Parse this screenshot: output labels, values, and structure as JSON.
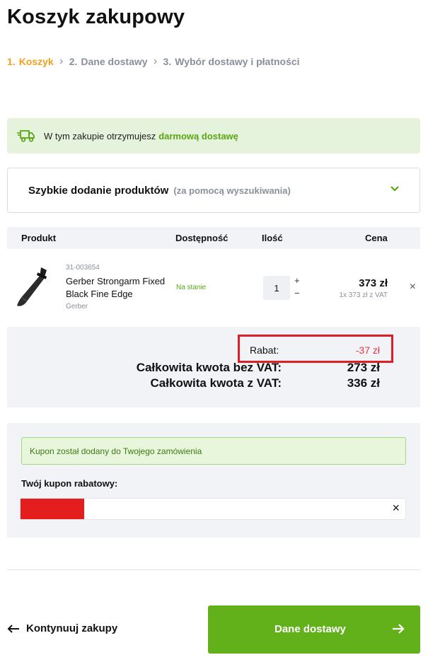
{
  "page": {
    "title": "Koszyk zakupowy"
  },
  "steps": [
    {
      "num": "1.",
      "label": "Koszyk"
    },
    {
      "num": "2.",
      "label": "Dane dostawy"
    },
    {
      "num": "3.",
      "label": "Wybór dostawy i płatności"
    }
  ],
  "promo": {
    "text": "W tym zakupie otrzymujesz",
    "highlight": "darmową dostawę",
    "icon": "truck-icon"
  },
  "quick_add": {
    "title": "Szybkie dodanie produktów",
    "subtitle": "(za pomocą wyszukiwania)",
    "icon": "chevron-down-icon"
  },
  "table": {
    "headers": {
      "product": "Produkt",
      "availability": "Dostępność",
      "quantity": "Ilość",
      "price": "Cena"
    }
  },
  "item": {
    "sku": "31-003654",
    "name": "Gerber Strongarm Fixed Black Fine Edge",
    "brand": "Gerber",
    "availability": "Na stanie",
    "quantity": "1",
    "plus": "+",
    "minus": "−",
    "price": "373 zł",
    "unit_price": "1x 373 zł z VAT",
    "remove": "×"
  },
  "summary": {
    "discount_label": "Rabat:",
    "discount_value": "-37 zł",
    "net_label": "Całkowita kwota bez VAT:",
    "net_value": "273 zł",
    "gross_label": "Całkowita kwota z VAT:",
    "gross_value": "336 zł"
  },
  "coupon": {
    "message": "Kupon został dodany do Twojego zamówienia",
    "label": "Twój kupon rabatowy:",
    "clear": "×"
  },
  "footer": {
    "back_label": "Kontynuuj zakupy",
    "next_label": "Dane dostawy"
  },
  "colors": {
    "accent_orange": "#f2a11b",
    "green": "#62b01a",
    "discount_red": "#e8344a",
    "highlight_box": "#dc1e26"
  }
}
